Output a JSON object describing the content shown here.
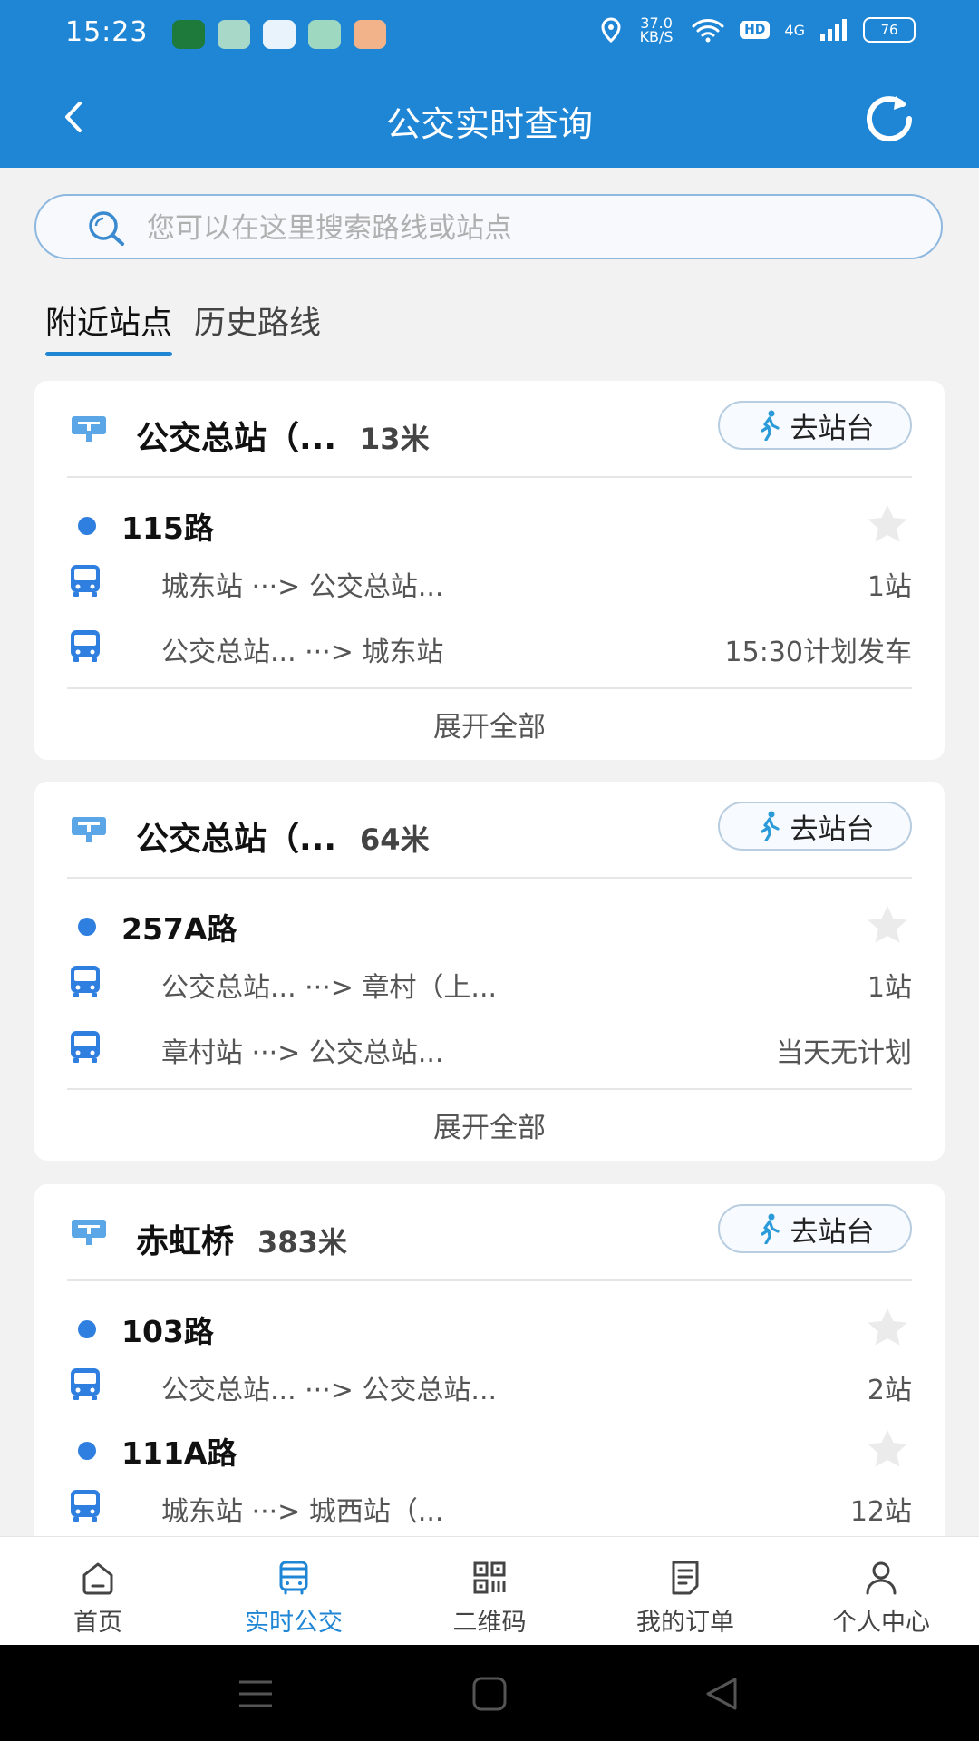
{
  "status_bar": {
    "time": "15:23",
    "net_speed": "37.0 KB/S",
    "hd": "HD",
    "signal": "4G",
    "battery": "76"
  },
  "header": {
    "title": "公交实时查询",
    "back_icon": "back-arrow-icon",
    "refresh_icon": "refresh-icon"
  },
  "search": {
    "placeholder": "您可以在这里搜索路线或站点",
    "value": ""
  },
  "tabs": [
    {
      "label": "附近站点",
      "active": true
    },
    {
      "label": "历史路线",
      "active": false
    }
  ],
  "goto_label": "去站台",
  "expand_label": "展开全部",
  "stations": [
    {
      "name": "公交总站（...",
      "distance": "13米",
      "routes": [
        {
          "name": "115路",
          "directions": [
            {
              "from": "城东站",
              "to": "公交总站...",
              "info": "1站"
            },
            {
              "from": "公交总站...",
              "to": "城东站",
              "info": "15:30计划发车"
            }
          ]
        }
      ]
    },
    {
      "name": "公交总站（...",
      "distance": "64米",
      "routes": [
        {
          "name": "257A路",
          "directions": [
            {
              "from": "公交总站...",
              "to": "章村（上...",
              "info": "1站"
            },
            {
              "from": "章村站",
              "to": "公交总站...",
              "info": "当天无计划"
            }
          ]
        }
      ]
    },
    {
      "name": "赤虹桥",
      "distance": "383米",
      "routes": [
        {
          "name": "103路",
          "directions": [
            {
              "from": "公交总站...",
              "to": "公交总站...",
              "info": "2站"
            }
          ]
        },
        {
          "name": "111A路",
          "directions": [
            {
              "from": "城东站",
              "to": "城西站（...",
              "info": "12站"
            }
          ]
        }
      ]
    }
  ],
  "bottom_nav": [
    {
      "label": "首页",
      "icon": "home-icon",
      "active": false
    },
    {
      "label": "实时公交",
      "icon": "bus-icon",
      "active": true
    },
    {
      "label": "二维码",
      "icon": "qr-code-icon",
      "active": false
    },
    {
      "label": "我的订单",
      "icon": "order-icon",
      "active": false
    },
    {
      "label": "个人中心",
      "icon": "person-icon",
      "active": false
    }
  ],
  "colors": {
    "primary": "#1f86d6",
    "dot": "#2f7fe0",
    "background": "#f2f2f2"
  }
}
